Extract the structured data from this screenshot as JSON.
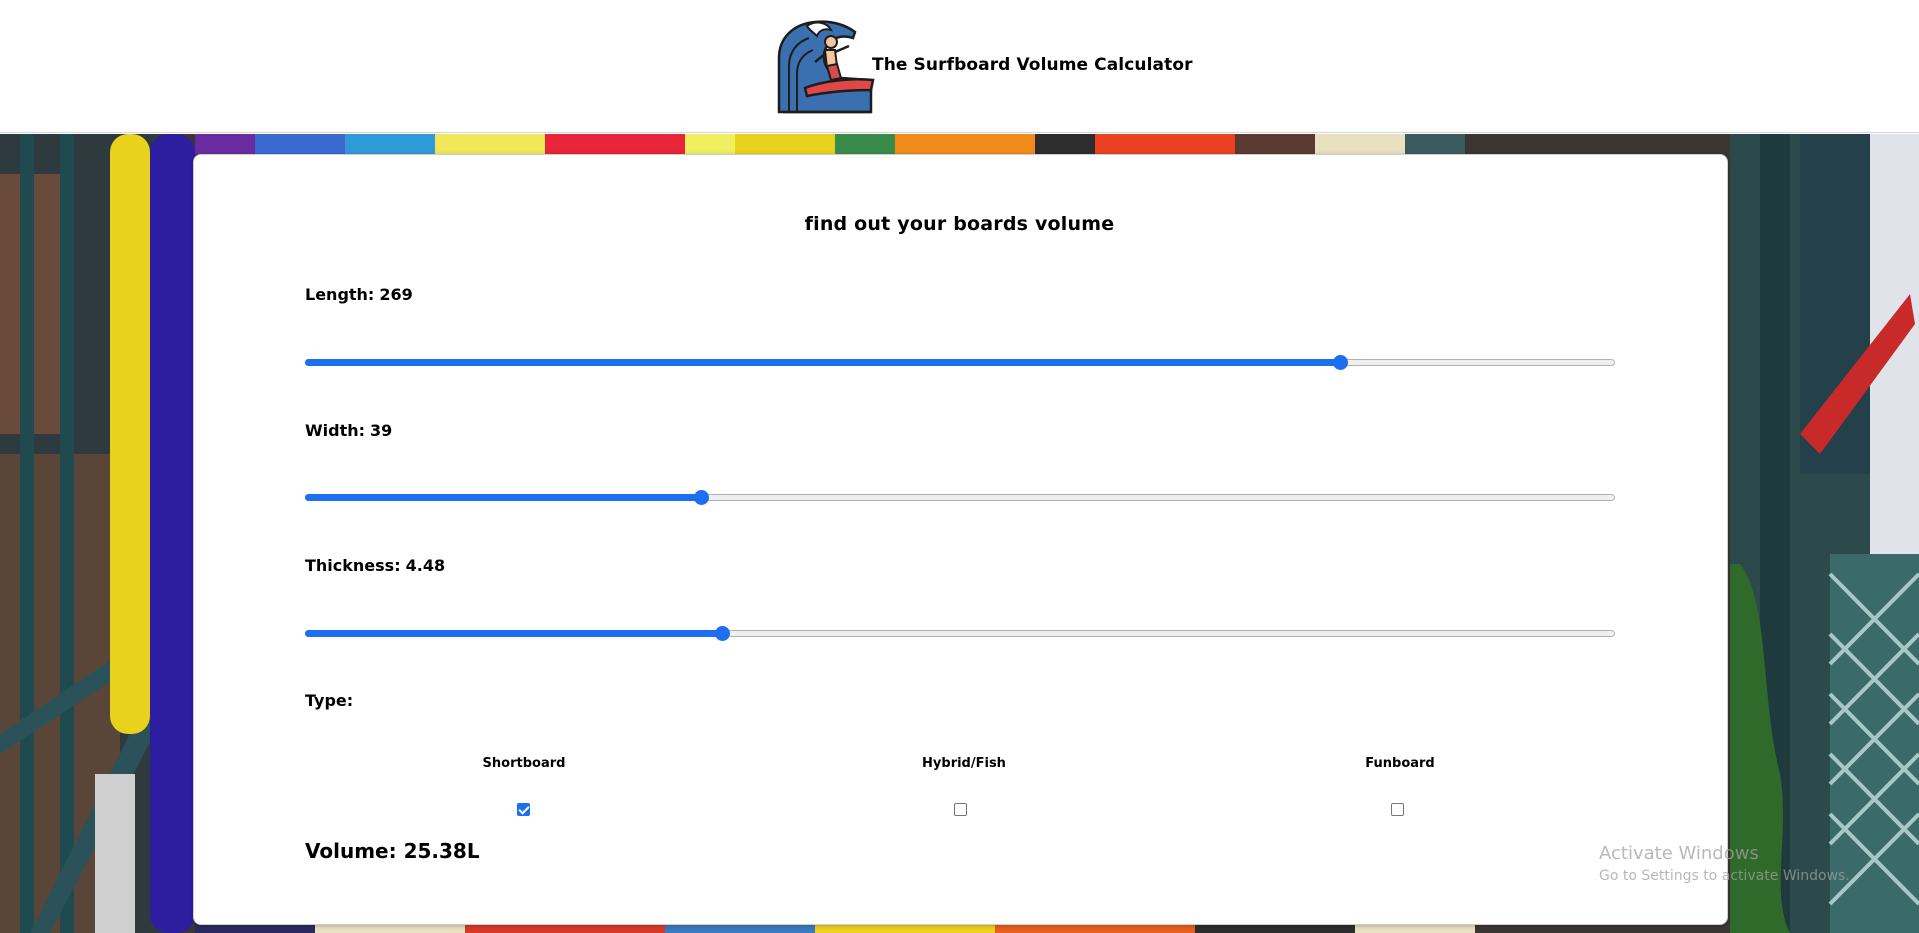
{
  "header": {
    "title": "The Surfboard Volume Calculator",
    "logo_icon": "surfer-wave-icon"
  },
  "calculator": {
    "heading": "find out your boards volume",
    "length": {
      "label": "Length:",
      "value": "269",
      "fraction": 0.79
    },
    "width": {
      "label": "Width:",
      "value": "39",
      "fraction": 0.302
    },
    "thickness": {
      "label": "Thickness:",
      "value": "4.48",
      "fraction": 0.318
    },
    "type_label": "Type:",
    "types": [
      {
        "label": "Shortboard",
        "checked": true
      },
      {
        "label": "Hybrid/Fish",
        "checked": false
      },
      {
        "label": "Funboard",
        "checked": false
      }
    ],
    "volume": "Volume: 25.38L"
  },
  "watermark": {
    "title": "Activate Windows",
    "subtitle": "Go to Settings to activate Windows."
  },
  "colors": {
    "accent": "#1b6ff0",
    "header_bg": "#ffffff",
    "card_bg": "#ffffff"
  }
}
